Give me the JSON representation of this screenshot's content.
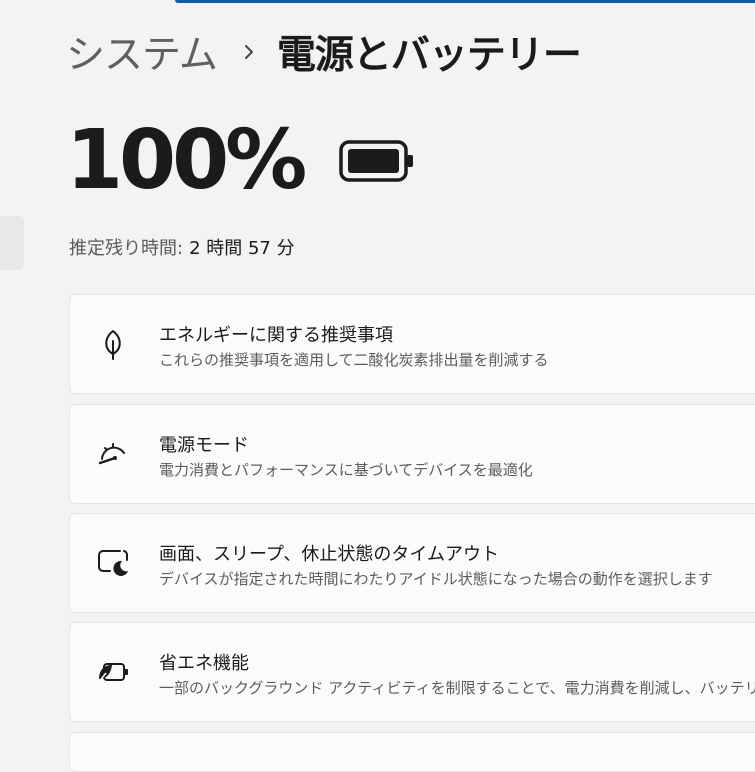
{
  "breadcrumb": {
    "parent": "システム",
    "separator": "›",
    "current": "電源とバッテリー"
  },
  "battery": {
    "percent": "100%",
    "level": 1.0,
    "icon": "battery-full-icon"
  },
  "remaining": {
    "label": "推定残り時間:",
    "value": "2 時間 57 分"
  },
  "cards": [
    {
      "icon": "leaf-icon",
      "title": "エネルギーに関する推奨事項",
      "description": "これらの推奨事項を適用して二酸化炭素排出量を削減する"
    },
    {
      "icon": "speedometer-icon",
      "title": "電源モード",
      "description": "電力消費とパフォーマンスに基づいてデバイスを最適化"
    },
    {
      "icon": "screen-sleep-icon",
      "title": "画面、スリープ、休止状態のタイムアウト",
      "description": "デバイスが指定された時間にわたりアイドル状態になった場合の動作を選択します"
    },
    {
      "icon": "battery-saver-icon",
      "title": "省エネ機能",
      "description": "一部のバックグラウンド アクティビティを制限することで、電力消費を削減し、バッテリーの"
    }
  ]
}
